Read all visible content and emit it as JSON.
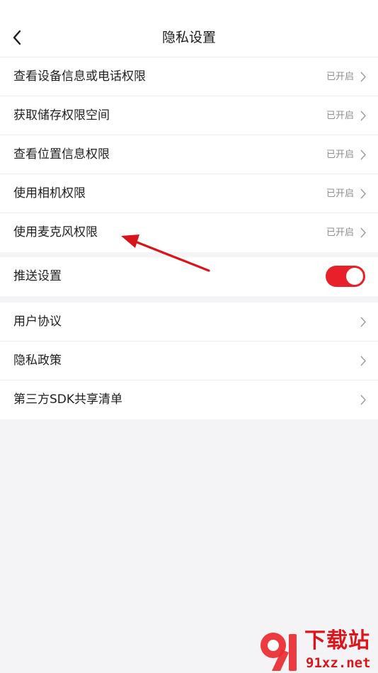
{
  "header": {
    "title": "隐私设置"
  },
  "permissions": [
    {
      "label": "查看设备信息或电话权限",
      "status": "已开启"
    },
    {
      "label": "获取储存权限空间",
      "status": "已开启"
    },
    {
      "label": "查看位置信息权限",
      "status": "已开启"
    },
    {
      "label": "使用相机权限",
      "status": "已开启"
    },
    {
      "label": "使用麦克风权限",
      "status": "已开启"
    }
  ],
  "push": {
    "label": "推送设置",
    "enabled": true
  },
  "links": [
    {
      "label": "用户协议"
    },
    {
      "label": "隐私政策"
    },
    {
      "label": "第三方SDK共享清单"
    }
  ],
  "watermark": {
    "brand": "下载站",
    "site": "91xz.net"
  },
  "colors": {
    "accent": "#e8202a",
    "background": "#f4f4f6"
  }
}
